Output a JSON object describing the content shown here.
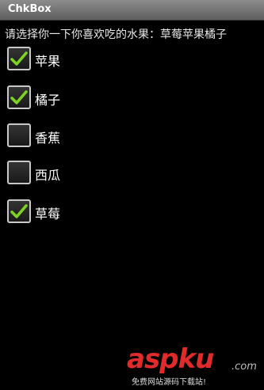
{
  "window": {
    "title": "ChkBox"
  },
  "prompt": "请选择你一下你喜欢吃的水果：草莓苹果橘子",
  "options": [
    {
      "label": "苹果",
      "checked": true
    },
    {
      "label": "橘子",
      "checked": true
    },
    {
      "label": "香蕉",
      "checked": false
    },
    {
      "label": "西瓜",
      "checked": false
    },
    {
      "label": "草莓",
      "checked": true
    }
  ],
  "watermark": {
    "logo": "aspku",
    "domain": ".com",
    "tagline": "免费网站源码下载站!"
  },
  "colors": {
    "check": "#7ed321",
    "title_bar": "#7a7a7a",
    "background": "#000000",
    "watermark": "#e12a2a"
  }
}
